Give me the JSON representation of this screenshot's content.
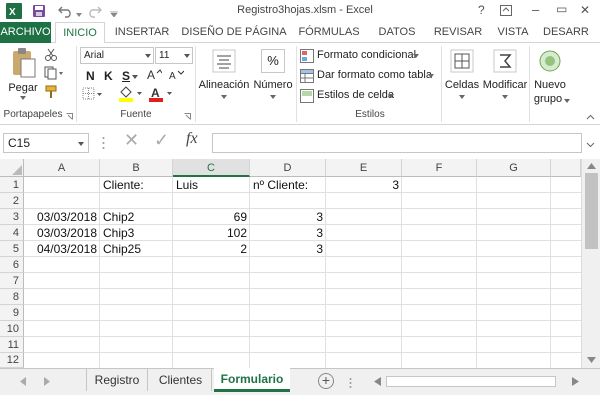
{
  "window": {
    "title": "Registro3hojas.xlsm - Excel",
    "help_glyph": "?",
    "minimize_glyph": "–",
    "restore_glyph": "▭",
    "close_glyph": "✕"
  },
  "ribbon_tabs": [
    {
      "label": "ARCHIVO"
    },
    {
      "label": "INICIO"
    },
    {
      "label": "INSERTAR"
    },
    {
      "label": "DISEÑO DE PÁGINA"
    },
    {
      "label": "FÓRMULAS"
    },
    {
      "label": "DATOS"
    },
    {
      "label": "REVISAR"
    },
    {
      "label": "VISTA"
    },
    {
      "label": "DESARR"
    }
  ],
  "ribbon": {
    "paste_label": "Pegar",
    "clipboard_label": "Portapapeles",
    "font_name": "Arial",
    "font_size": "11",
    "bold": "N",
    "italic": "K",
    "underline": "S",
    "font_label": "Fuente",
    "alignment_label": "Alineación",
    "number_label": "Número",
    "percent_glyph": "%",
    "cond_format_label": "Formato condicional",
    "table_format_label": "Dar formato como tabla",
    "cell_styles_label": "Estilos de celda",
    "styles_label": "Estilos",
    "cells_label": "Celdas",
    "modify_label": "Modificar",
    "new_group_line1": "Nuevo",
    "new_group_line2": "grupo"
  },
  "formula_bar": {
    "name_box": "C15",
    "fx": "fx",
    "cancel_glyph": "✕",
    "enter_glyph": "✓",
    "formula": ""
  },
  "columns": [
    "A",
    "B",
    "C",
    "D",
    "E",
    "F",
    "G"
  ],
  "rows": [
    "1",
    "2",
    "3",
    "4",
    "5",
    "6",
    "7",
    "8",
    "9",
    "10",
    "11",
    "12"
  ],
  "cells": {
    "B1": "Cliente:",
    "C1": "Luis",
    "D1": "nº Cliente:",
    "E1": "3",
    "A3": "03/03/2018",
    "B3": "Chip2",
    "C3": "69",
    "D3": "3",
    "A4": "03/03/2018",
    "B4": "Chip3",
    "C4": "102",
    "D4": "3",
    "A5": "04/03/2018",
    "B5": "Chip25",
    "C5": "2",
    "D5": "3"
  },
  "sheets": [
    {
      "label": "Registro"
    },
    {
      "label": "Clientes"
    },
    {
      "label": "Formulario"
    }
  ],
  "add_sheet_glyph": "+",
  "colors": {
    "accent_green": "#217346",
    "file_tab": "#1e7145"
  }
}
